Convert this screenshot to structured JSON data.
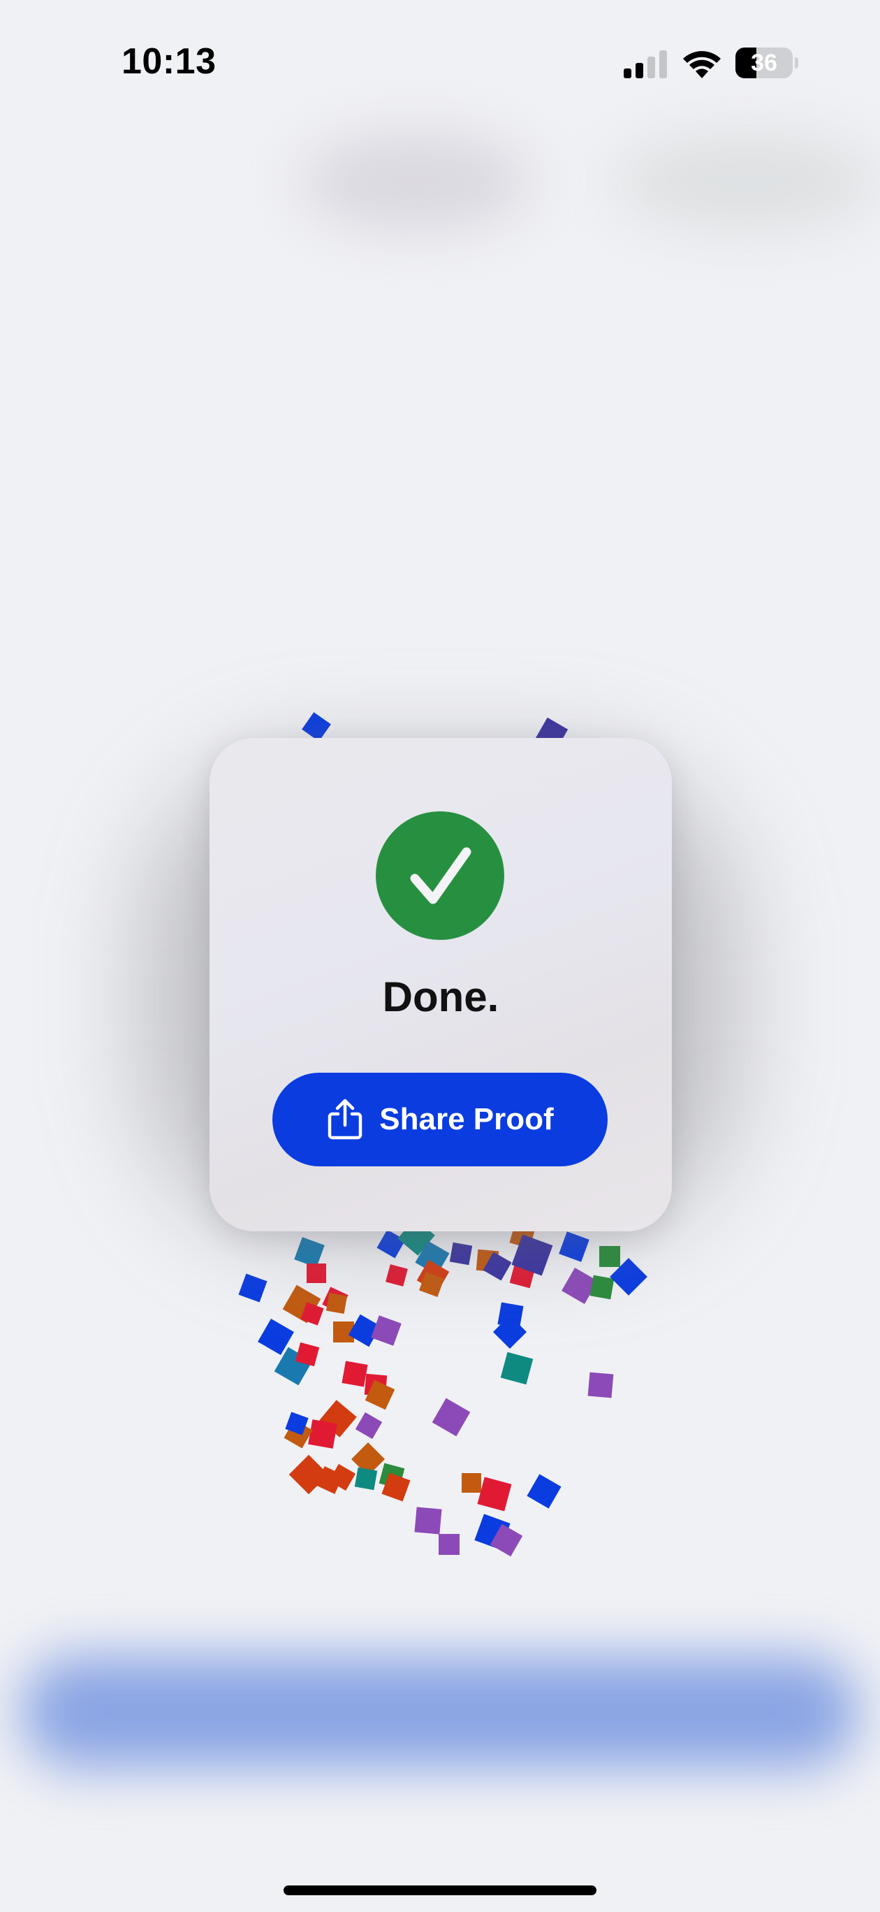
{
  "status_bar": {
    "time": "10:13",
    "battery_percent": "36",
    "battery_level": 0.36,
    "signal_bars_active": 2,
    "signal_bars_total": 4
  },
  "dialog": {
    "icon": "checkmark-circle-icon",
    "title": "Done.",
    "share_button": {
      "label": "Share Proof",
      "icon": "share-icon"
    }
  },
  "colors": {
    "success_green": "#279040",
    "button_blue": "#0a3ce0",
    "confetti": [
      "#0a3ce0",
      "#3a33a0",
      "#e01a33",
      "#d23c10",
      "#c25a10",
      "#0f8a80",
      "#2a8c3c",
      "#8c4ab8",
      "#1a7ab0"
    ]
  }
}
